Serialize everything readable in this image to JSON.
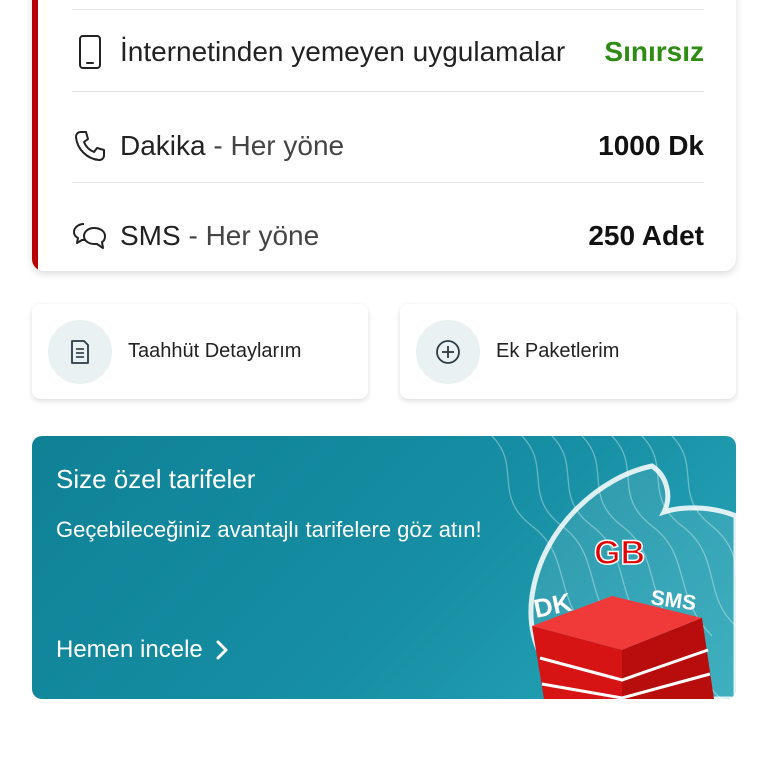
{
  "usage": {
    "internet_apps": {
      "label": "İnternetinden yemeyen uygulamalar",
      "value": "Sınırsız",
      "icon": "phone-icon"
    },
    "minutes": {
      "label": "Dakika",
      "sub": " - Her yöne",
      "value": "1000 Dk",
      "icon": "phone-call-icon"
    },
    "sms": {
      "label": "SMS",
      "sub": " - Her yöne",
      "value": "250 Adet",
      "icon": "chat-bubbles-icon"
    }
  },
  "actions": {
    "commitment": {
      "label": "Taahhüt Detaylarım",
      "icon": "document-icon"
    },
    "addons": {
      "label": "Ek Paketlerim",
      "icon": "plus-circle-icon"
    }
  },
  "promo": {
    "title": "Size özel tarifeler",
    "subtitle": "Geçebileceğiniz avantajlı tarifelere göz atın!",
    "cta": "Hemen incele",
    "art_labels": {
      "gb": "GB",
      "dk": "DK",
      "sms": "SMS"
    }
  },
  "colors": {
    "accent_red": "#b60000",
    "unlimited_green": "#2e8b14",
    "promo_teal": "#168ea3"
  }
}
